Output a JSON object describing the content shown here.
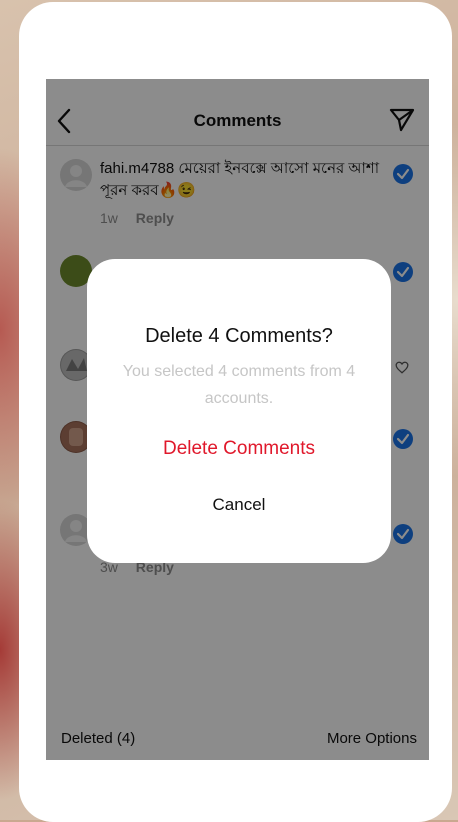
{
  "header": {
    "title": "Comments"
  },
  "comments": [
    {
      "username": "fahi.m4788",
      "text": "মেয়েরা ইনবক্সে আসো মনের আশা পূরন করব🔥😉",
      "time": "1w",
      "reply": "Reply",
      "selected": true
    },
    {
      "time": "3w",
      "reply": "Reply"
    }
  ],
  "dialog": {
    "title": "Delete 4 Comments?",
    "body": "You selected 4 comments from 4 accounts.",
    "delete_label": "Delete Comments",
    "cancel_label": "Cancel"
  },
  "footer": {
    "deleted_label": "Deleted (4)",
    "more_options_label": "More Options"
  },
  "colors": {
    "accent_blue": "#1a73e8",
    "danger_red": "#e0182b"
  }
}
